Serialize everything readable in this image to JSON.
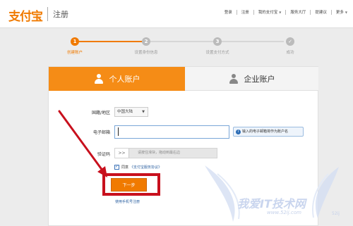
{
  "header": {
    "logo": "支付宝",
    "page_title": "注册",
    "nav": [
      "登录",
      "注册",
      "我的支付宝",
      "服务大厅",
      "提建议",
      "更多"
    ]
  },
  "steps": [
    {
      "num": "1",
      "label": "创建账户",
      "active": true
    },
    {
      "num": "2",
      "label": "设置身份信息",
      "active": false
    },
    {
      "num": "3",
      "label": "设置支付方式",
      "active": false
    },
    {
      "num": "✓",
      "label": "成功",
      "active": false
    }
  ],
  "tabs": {
    "personal": "个人账户",
    "business": "企业账户"
  },
  "form": {
    "region_label": "国籍/地区",
    "region_value": "中国大陆",
    "email_label": "电子邮箱",
    "email_value": "",
    "email_hint": "输入的电子邮箱将作为账户名",
    "captcha_label": "验证码",
    "slider_handle": ">>",
    "slider_text": "请按住滑块，拖动到最右边",
    "agree_prefix": "同意",
    "agree_link": "《支付宝服务协议》",
    "next_button": "下一步",
    "mobile_link": "使用手机号注册"
  },
  "watermark": {
    "title": "我爱IT技术网",
    "url": "www.52ij.com",
    "tag": "52ij"
  },
  "colors": {
    "brand_orange": "#f07a00",
    "annotation_red": "#c8101d",
    "link_blue": "#2a5fa0"
  }
}
